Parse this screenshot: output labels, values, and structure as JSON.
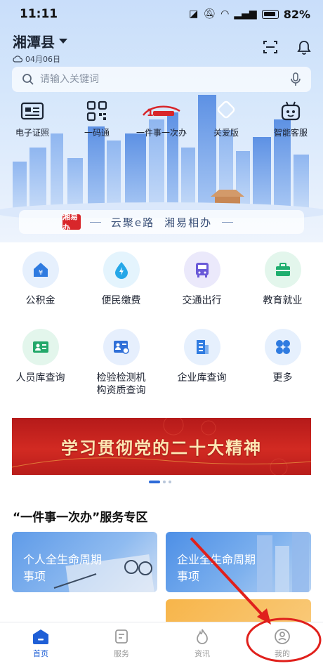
{
  "status": {
    "time": "11:11",
    "battery": "82%"
  },
  "header": {
    "location": "湘潭县",
    "date": "04月06日"
  },
  "search": {
    "placeholder": "请输入关键词"
  },
  "quick_actions": [
    {
      "label": "电子证照",
      "icon": "id-card-icon"
    },
    {
      "label": "一码通",
      "icon": "qr-code-icon"
    },
    {
      "label": "一件事一次办",
      "icon": "one-thing-logo-icon"
    },
    {
      "label": "关爱版",
      "icon": "heart-icon"
    },
    {
      "label": "智能客服",
      "icon": "robot-icon"
    }
  ],
  "slogan": {
    "logo_text": "湘易办",
    "left": "云聚e路",
    "right": "湘易相办"
  },
  "services": [
    {
      "label": "公积金",
      "icon": "housing-fund-icon",
      "color": "#2f7be0"
    },
    {
      "label": "便民缴费",
      "icon": "payment-icon",
      "color": "#25a7e8"
    },
    {
      "label": "交通出行",
      "icon": "bus-icon",
      "color": "#6a5ad8"
    },
    {
      "label": "教育就业",
      "icon": "briefcase-icon",
      "color": "#1fae6e"
    },
    {
      "label": "人员库查询",
      "icon": "person-card-icon",
      "color": "#23a86a"
    },
    {
      "label": "检验检测机构资质查询",
      "line1": "检验检测机",
      "line2": "构资质查询",
      "icon": "inspection-icon",
      "color": "#2f6fd8"
    },
    {
      "label": "企业库查询",
      "icon": "building-icon",
      "color": "#2f7be0"
    },
    {
      "label": "更多",
      "icon": "more-grid-icon",
      "color": "#2f7be0"
    }
  ],
  "banner": {
    "text": "学习贯彻党的二十大精神"
  },
  "carousel": {
    "count": 3,
    "active": 1
  },
  "section": {
    "title": "“一件事一次办”服务专区"
  },
  "cards": [
    {
      "line1": "个人全生命周期",
      "line2": "事项"
    },
    {
      "line1": "企业全生命周期",
      "line2": "事项"
    }
  ],
  "tabs": [
    {
      "label": "首页",
      "icon": "home-icon",
      "active": true
    },
    {
      "label": "服务",
      "icon": "service-icon",
      "active": false
    },
    {
      "label": "资讯",
      "icon": "news-icon",
      "active": false
    },
    {
      "label": "我的",
      "icon": "profile-icon",
      "active": false
    }
  ],
  "colors": {
    "primary": "#1f5fd6",
    "banner_red": "#c8201c",
    "annotation_red": "#e0201c"
  }
}
